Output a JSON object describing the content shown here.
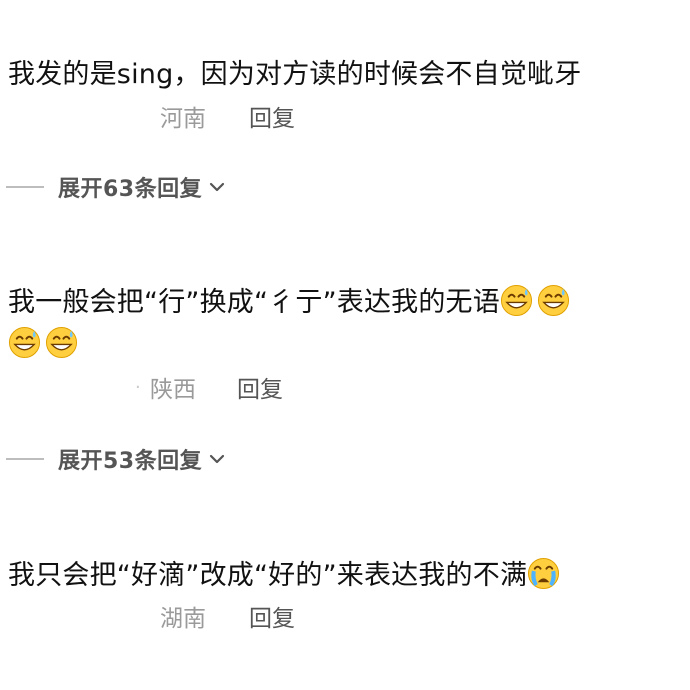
{
  "comments": [
    {
      "text": "我发的是sing，因为对方读的时候会不自觉呲牙",
      "location": "河南",
      "reply_label": "回复",
      "expand_label": "展开63条回复"
    },
    {
      "text_line1": "我一般会把“行”换成“彳亍”表达我的无语",
      "location": "陕西",
      "user_fragment": "·",
      "reply_label": "回复",
      "expand_label": "展开53条回复",
      "emoji_name": "grin-sweat-emoji"
    },
    {
      "text": "我只会把“好滴”改成“好的”来表达我的不满",
      "location": "湖南",
      "reply_label": "回复",
      "emoji_name": "crying-emoji"
    }
  ],
  "icons": {
    "expand_chevron": "chevron-down-icon"
  },
  "colors": {
    "text": "#111111",
    "meta": "#9a9a9a",
    "reply": "#555555",
    "divider": "#bdbdbd"
  }
}
